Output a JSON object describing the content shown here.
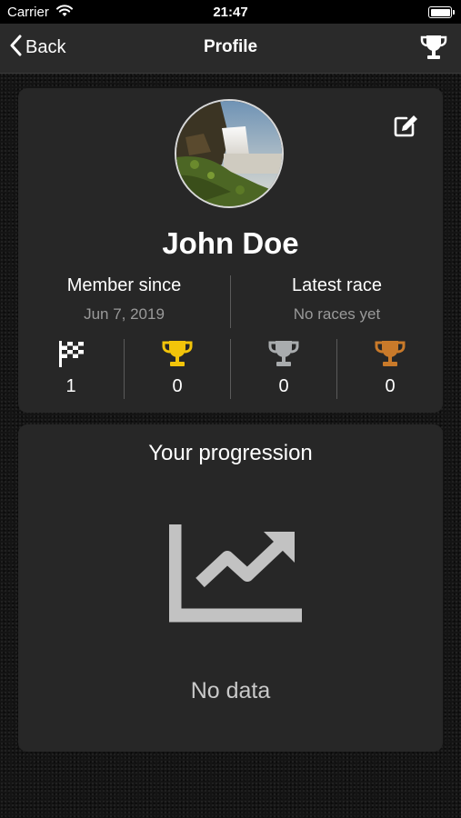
{
  "status_bar": {
    "carrier": "Carrier",
    "time": "21:47"
  },
  "nav": {
    "back_label": "Back",
    "title": "Profile",
    "right_icon": "trophy-icon"
  },
  "profile": {
    "name": "John Doe",
    "member_since_label": "Member since",
    "member_since_value": "Jun 7, 2019",
    "latest_race_label": "Latest race",
    "latest_race_value": "No races yet",
    "stats": [
      {
        "icon": "checkered-flag-icon",
        "value": "1"
      },
      {
        "icon": "gold-trophy-icon",
        "value": "0",
        "color": "#f2c40a"
      },
      {
        "icon": "silver-trophy-icon",
        "value": "0",
        "color": "#a9acae"
      },
      {
        "icon": "bronze-trophy-icon",
        "value": "0",
        "color": "#c97a2a"
      }
    ]
  },
  "progression": {
    "title": "Your progression",
    "empty_text": "No data",
    "icon": "chart-line-icon"
  },
  "colors": {
    "background": "#141414",
    "card": "#272727",
    "nav": "#2a2a2a"
  }
}
